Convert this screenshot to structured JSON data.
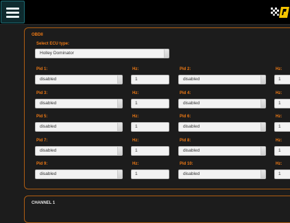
{
  "header": {
    "menu_icon": "hamburger-menu-icon",
    "logo_icon": "checkered-flag-logo"
  },
  "obd": {
    "section_title": "OBDII",
    "ecu_label": "Select ECU type:",
    "ecu_value": "Holley Dominator",
    "hz_label": "Hz:",
    "pids": [
      {
        "label": "Pid 1:",
        "value": "disabled",
        "hz": "1"
      },
      {
        "label": "Pid 2:",
        "value": "disabled",
        "hz": "1"
      },
      {
        "label": "Pid 3:",
        "value": "disabled",
        "hz": "1"
      },
      {
        "label": "Pid 4:",
        "value": "disabled",
        "hz": "1"
      },
      {
        "label": "Pid 5:",
        "value": "disabled",
        "hz": "1"
      },
      {
        "label": "Pid 6:",
        "value": "disabled",
        "hz": "1"
      },
      {
        "label": "Pid 7:",
        "value": "disabled",
        "hz": "1"
      },
      {
        "label": "Pid 8:",
        "value": "disabled",
        "hz": "1"
      },
      {
        "label": "Pid 9:",
        "value": "disabled",
        "hz": "1"
      },
      {
        "label": "Pid 10:",
        "value": "disabled",
        "hz": "1"
      }
    ]
  },
  "channel": {
    "section_title": "CHANNEL 1"
  },
  "colors": {
    "accent": "#f07a14",
    "border": "#b25f12",
    "background": "#1c1c1c"
  }
}
